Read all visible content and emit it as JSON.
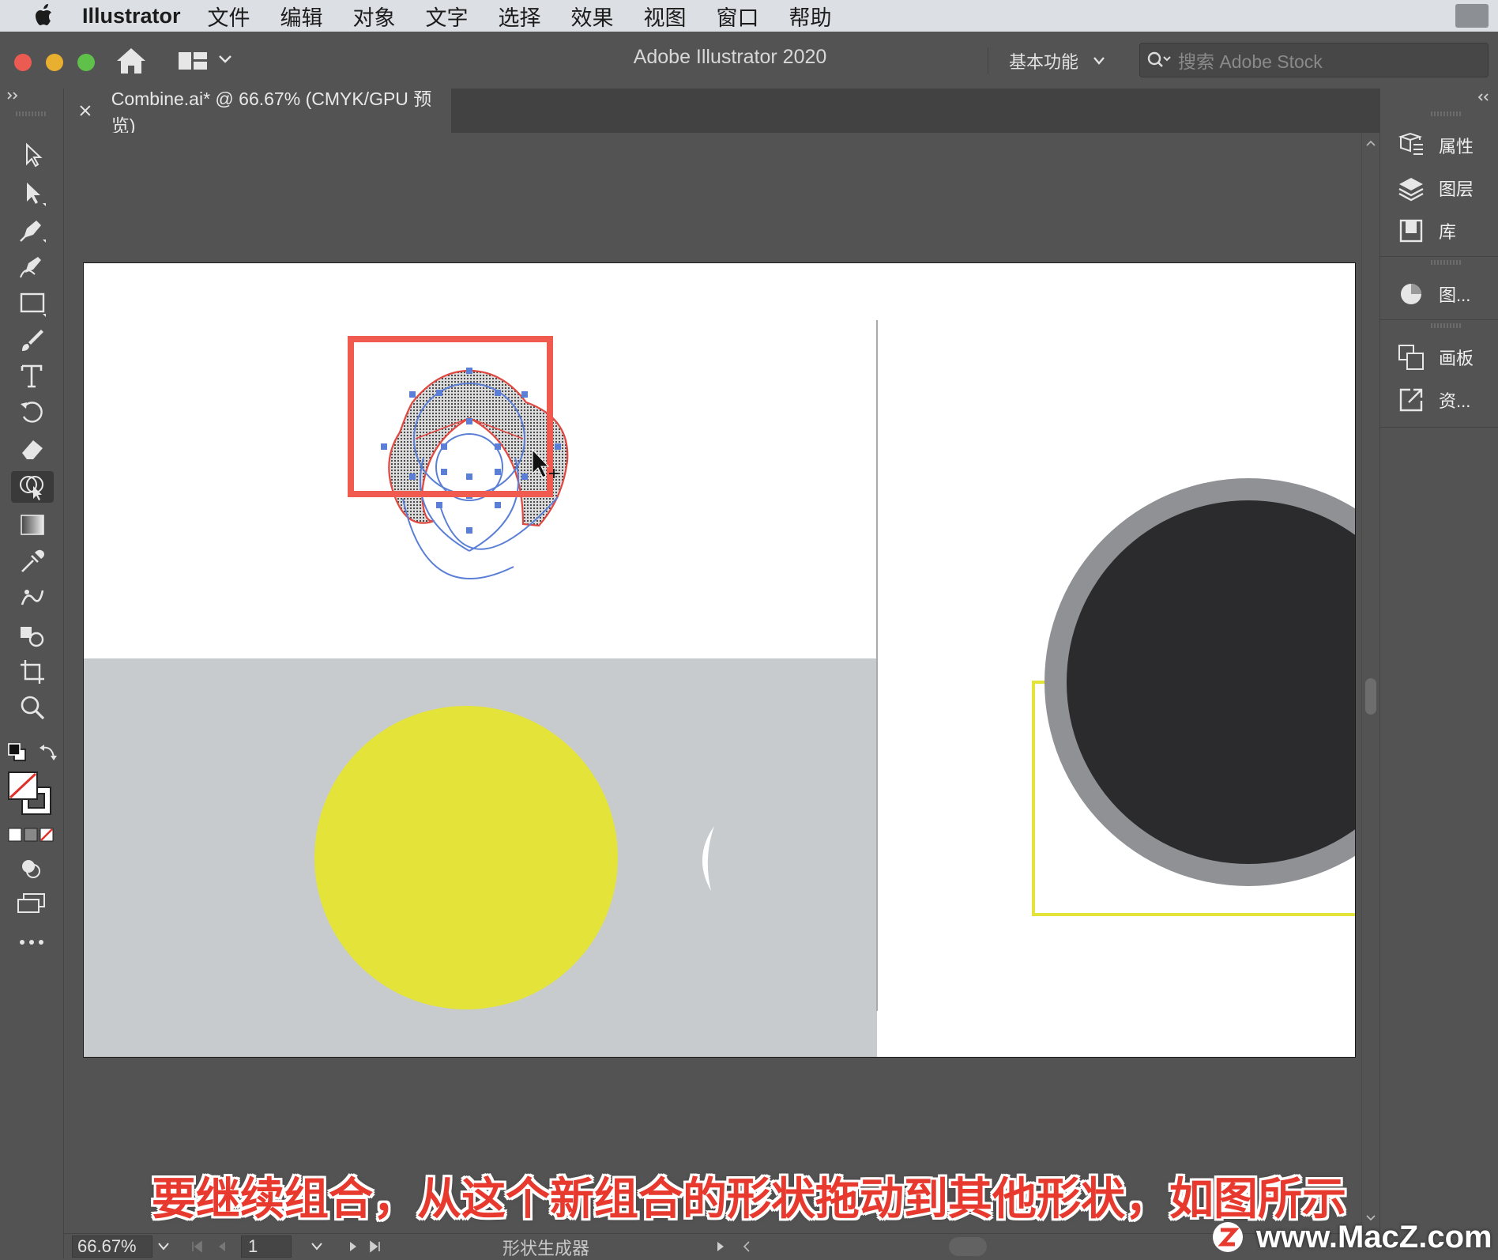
{
  "menubar": {
    "app_name": "Illustrator",
    "items": [
      "文件",
      "编辑",
      "对象",
      "文字",
      "选择",
      "效果",
      "视图",
      "窗口",
      "帮助"
    ]
  },
  "titlebar": {
    "title": "Adobe Illustrator 2020",
    "workspace": "基本功能",
    "search_placeholder": "搜索 Adobe Stock"
  },
  "document_tab": {
    "label": "Combine.ai* @ 66.67% (CMYK/GPU 预览)"
  },
  "tools": [
    {
      "name": "selection-tool-icon"
    },
    {
      "name": "direct-selection-tool-icon"
    },
    {
      "name": "pen-tool-icon"
    },
    {
      "name": "curvature-tool-icon"
    },
    {
      "name": "rectangle-tool-icon"
    },
    {
      "name": "paintbrush-tool-icon"
    },
    {
      "name": "type-tool-icon"
    },
    {
      "name": "rotate-tool-icon"
    },
    {
      "name": "eraser-tool-icon"
    },
    {
      "name": "shape-builder-tool-icon",
      "active": true
    },
    {
      "name": "gradient-tool-icon"
    },
    {
      "name": "eyedropper-tool-icon"
    },
    {
      "name": "puppet-warp-tool-icon"
    },
    {
      "name": "symbol-sprayer-tool-icon"
    },
    {
      "name": "artboard-tool-icon"
    },
    {
      "name": "zoom-tool-icon"
    }
  ],
  "panels": [
    {
      "label": "属性",
      "icon": "properties-icon"
    },
    {
      "label": "图层",
      "icon": "layers-icon"
    },
    {
      "label": "库",
      "icon": "libraries-icon"
    },
    {
      "label": "图...",
      "icon": "graphic-styles-icon"
    },
    {
      "label": "画板",
      "icon": "artboards-icon"
    },
    {
      "label": "资...",
      "icon": "asset-export-icon"
    }
  ],
  "statusbar": {
    "zoom": "66.67%",
    "page": "1",
    "tool_name": "形状生成器"
  },
  "colors": {
    "highlight_box": "#f05a4f",
    "yellow_circle": "#e3e33a",
    "dark_circle": "#2b2b2d",
    "ring": "#8f9195",
    "gray_panel": "#c8cbcd",
    "path_selection": "#5b7fd6"
  },
  "caption": "要继续组合，从这个新组合的形状拖动到其他形状，如图所示",
  "watermark": "www.MacZ.com"
}
